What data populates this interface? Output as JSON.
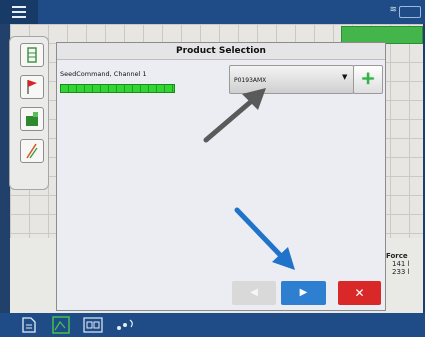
{
  "dialog": {
    "title": "Product Selection",
    "channel_label": "SeedCommand, Channel 1",
    "product_value": "P0193AMX",
    "dropdown_arrow": "▼",
    "add_icon_glyph": "+"
  },
  "nav": {
    "back_glyph": "◀",
    "next_glyph": "▶",
    "cancel_glyph": "✕"
  },
  "background": {
    "right_panel_title": "Force",
    "right_panel_value_1": "141 l",
    "right_panel_value_2": "233 l",
    "top_right_text": "≋"
  },
  "colors": {
    "accent_blue": "#2f7fd0",
    "cancel_red": "#d92828",
    "add_green": "#2db843",
    "channel_green": "#33d433",
    "annotation_gray": "#5a5a5a",
    "annotation_blue": "#1f73c8"
  }
}
